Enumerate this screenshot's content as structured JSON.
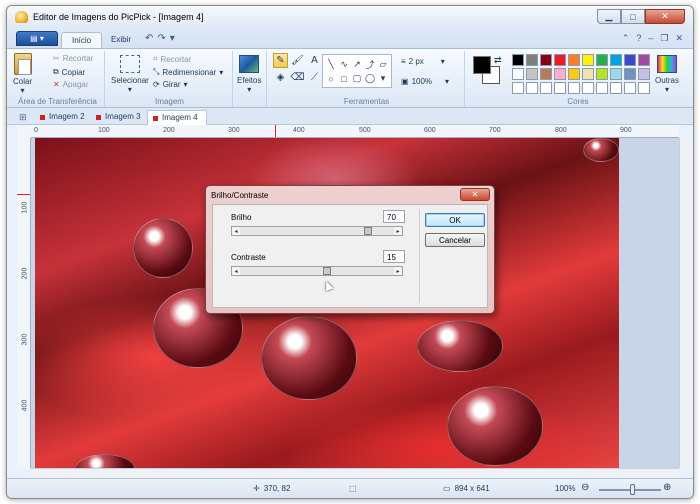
{
  "window": {
    "title": "Editor de Imagens do PicPick - [Imagem 4]"
  },
  "menu": {
    "app_button": "▤ ▾",
    "tabs": [
      "Início",
      "Exibir"
    ]
  },
  "ribbon": {
    "clipboard": {
      "paste": "Colar",
      "cut": "Recortar",
      "copy": "Copiar",
      "delete": "Apagar",
      "group": "Área de Transferência"
    },
    "image": {
      "select": "Selecionar",
      "crop": "Recortar",
      "resize": "Redimensionar",
      "rotate": "Girar",
      "group": "Imagem"
    },
    "effects": {
      "label": "Efeitos"
    },
    "tools": {
      "group": "Ferramentas",
      "line_width": "2 px",
      "opacity": "100%"
    },
    "colors": {
      "group": "Cores",
      "more": "Outras"
    },
    "palette": [
      "#000000",
      "#7f7f7f",
      "#880015",
      "#ed1c24",
      "#ff7f27",
      "#fff200",
      "#22b14c",
      "#00a2e8",
      "#3f48cc",
      "#a349a4",
      "#ffffff",
      "#c3c3c3",
      "#b97a57",
      "#ffaec9",
      "#ffc90e",
      "#efe4b0",
      "#b5e61d",
      "#99d9ea",
      "#7092be",
      "#c8bfe7",
      "#ffffff",
      "#ffffff",
      "#ffffff",
      "#ffffff",
      "#ffffff",
      "#ffffff",
      "#ffffff",
      "#ffffff",
      "#ffffff",
      "#ffffff"
    ],
    "primary_color": "#000000",
    "secondary_color": "#ffffff"
  },
  "documents": {
    "tabs": [
      "Imagem 2",
      "Imagem 3",
      "Imagem 4"
    ],
    "active": "Imagem 4"
  },
  "ruler": {
    "h_ticks": [
      "0",
      "100",
      "200",
      "300",
      "400",
      "500",
      "600",
      "700",
      "800",
      "900"
    ],
    "v_ticks": [
      "100",
      "200",
      "300",
      "400"
    ]
  },
  "dialog": {
    "title": "Brilho/Contraste",
    "brightness_label": "Brilho",
    "brightness_value": "70",
    "brightness_level": 0.85,
    "contrast_label": "Contraste",
    "contrast_value": "15",
    "contrast_level": 0.57,
    "ok": "OK",
    "cancel": "Cancelar"
  },
  "status": {
    "cursor": "370, 82",
    "size": "894 x 641",
    "zoom": "100%"
  }
}
